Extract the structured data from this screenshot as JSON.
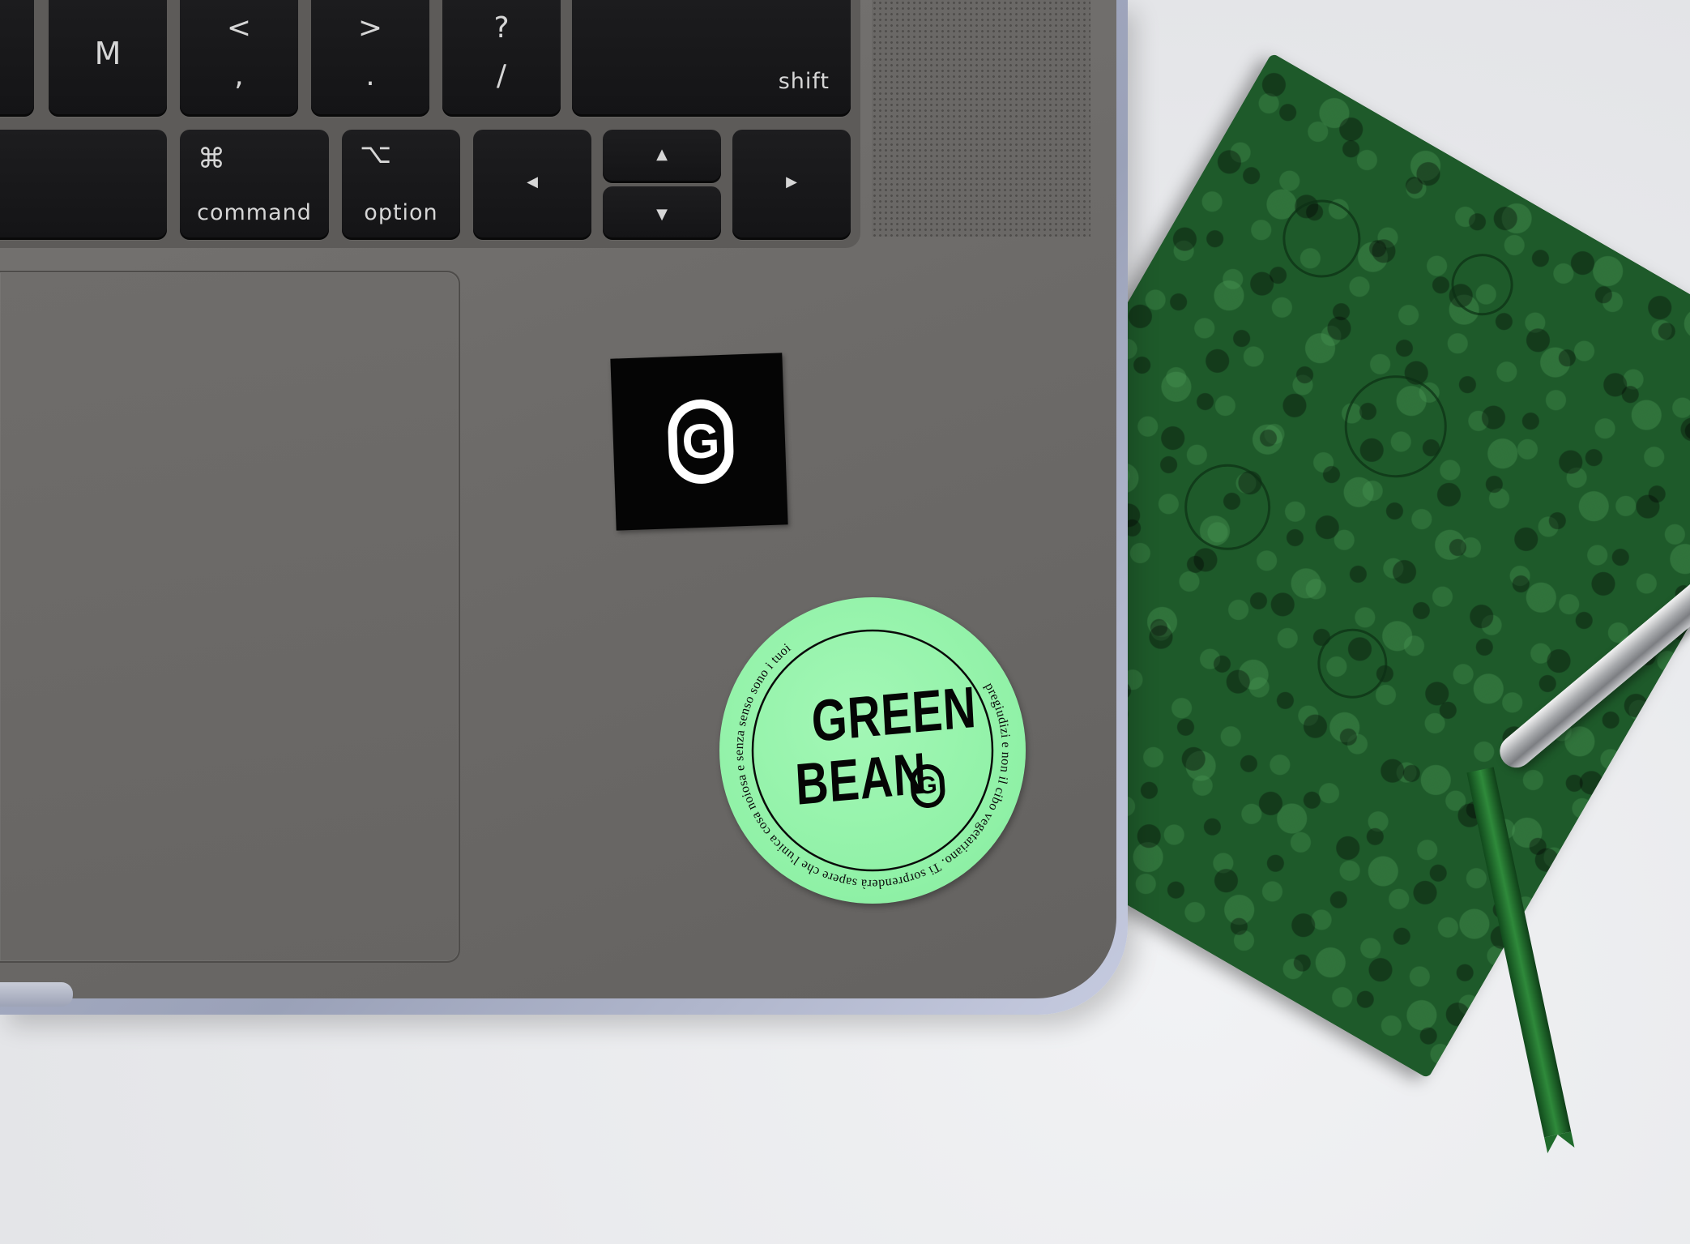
{
  "keyboard": {
    "keys_row1": [
      {
        "label": "M"
      },
      {
        "top": "<",
        "bottom": ","
      },
      {
        "top": ">",
        "bottom": "."
      },
      {
        "top": "?",
        "bottom": "/"
      },
      {
        "label": "shift"
      }
    ],
    "keys_row2": [
      {
        "symbol": "⌘",
        "label": "command"
      },
      {
        "symbol": "⌥",
        "label": "option"
      },
      {
        "arrow": "◀"
      },
      {
        "arrow_up": "▲",
        "arrow_down": "▼"
      },
      {
        "arrow": "▶"
      }
    ]
  },
  "stickers": {
    "square": {
      "mark": "G",
      "color": "#050505"
    },
    "round": {
      "brand_line1": "GREEN",
      "brand_line2": "BEAN",
      "brand_mark": "G",
      "ring_text": "pregiudizi e non il cibo vegetariano. Ti sorprenderà sapere che l'unica cosa noiosa e senza senso sono i tuoi ",
      "color": "#90f2a8"
    }
  },
  "colors": {
    "laptop": "#6d6b69",
    "notebook": "#1e5a2a",
    "desk": "#e9eaec"
  }
}
